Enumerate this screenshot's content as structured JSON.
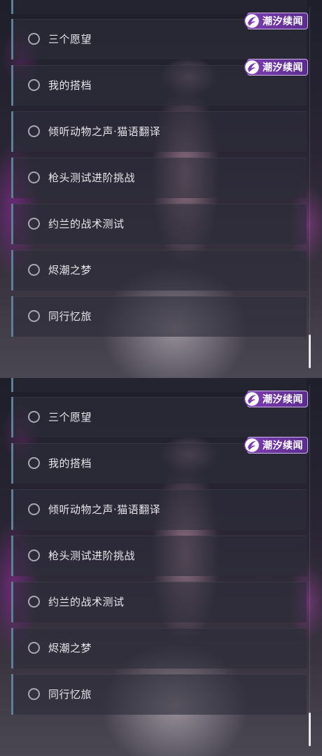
{
  "panels": [
    {
      "items": [
        {
          "label": "三个愿望",
          "badge": "潮汐续闻"
        },
        {
          "label": "我的搭档",
          "badge": "潮汐续闻"
        },
        {
          "label": "倾听动物之声·猫语翻译"
        },
        {
          "label": "枪头测试进阶挑战"
        },
        {
          "label": "约兰的战术测试"
        },
        {
          "label": "烬潮之梦"
        },
        {
          "label": "同行忆旅"
        }
      ]
    },
    {
      "items": [
        {
          "label": "三个愿望",
          "badge": "潮汐续闻"
        },
        {
          "label": "我的搭档",
          "badge": "潮汐续闻"
        },
        {
          "label": "倾听动物之声·猫语翻译"
        },
        {
          "label": "枪头测试进阶挑战"
        },
        {
          "label": "约兰的战术测试"
        },
        {
          "label": "烬潮之梦"
        },
        {
          "label": "同行忆旅"
        }
      ]
    }
  ],
  "colors": {
    "accent_bar": "#5f7f95",
    "badge_fill": "#7c3cb0",
    "badge_border": "#cfb4f0",
    "text": "#e6e6ea"
  },
  "icons": {
    "status": "empty-circle-icon",
    "badge_logo": "tide-logo-icon"
  }
}
